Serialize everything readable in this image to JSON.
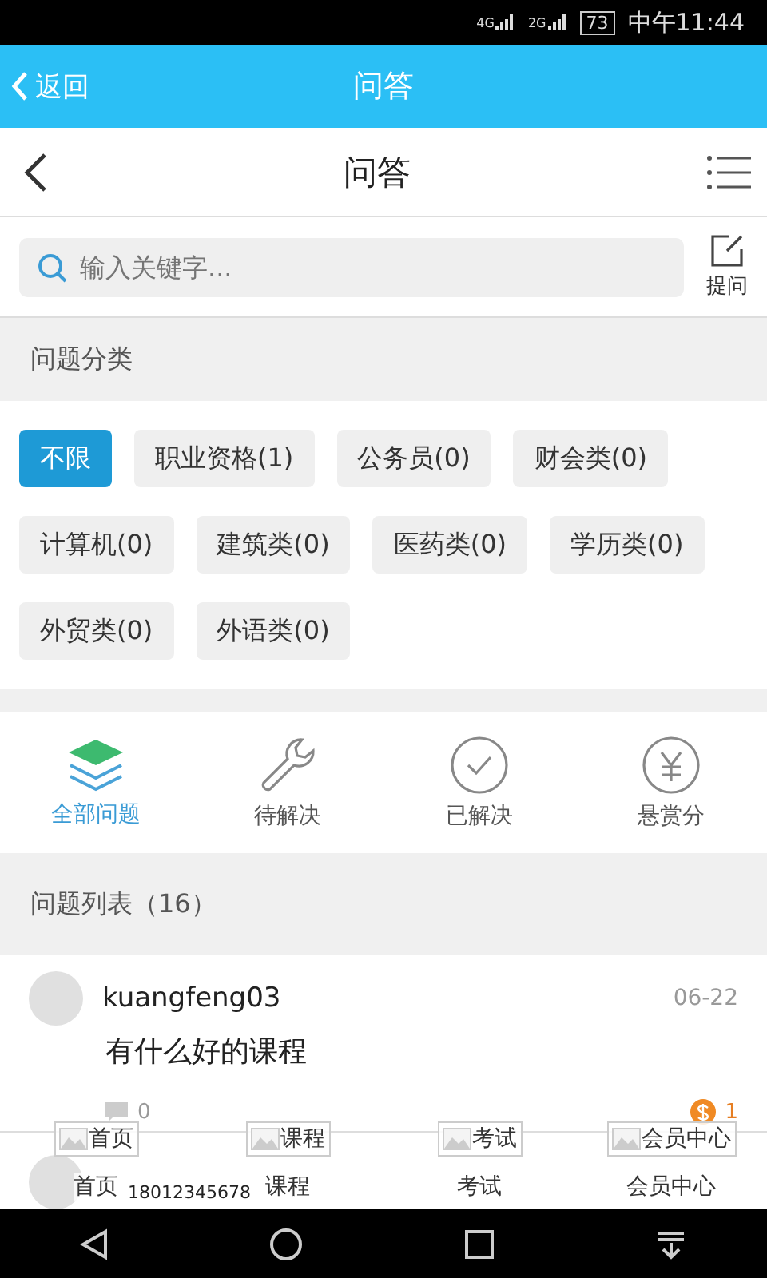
{
  "status_bar": {
    "network_1": "4G",
    "network_2": "2G",
    "battery": "73",
    "time": "中午11:44"
  },
  "app_bar": {
    "back": "返回",
    "title": "问答"
  },
  "header": {
    "title": "问答"
  },
  "search": {
    "placeholder": "输入关键字...",
    "ask": "提问"
  },
  "category_section": {
    "title": "问题分类"
  },
  "categories": [
    {
      "label": "不限",
      "selected": true
    },
    {
      "label": "职业资格(1)",
      "selected": false
    },
    {
      "label": "公务员(0)",
      "selected": false
    },
    {
      "label": "财会类(0)",
      "selected": false
    },
    {
      "label": "计算机(0)",
      "selected": false
    },
    {
      "label": "建筑类(0)",
      "selected": false
    },
    {
      "label": "医药类(0)",
      "selected": false
    },
    {
      "label": "学历类(0)",
      "selected": false
    },
    {
      "label": "外贸类(0)",
      "selected": false
    },
    {
      "label": "外语类(0)",
      "selected": false
    }
  ],
  "filters": [
    {
      "kind": "layers",
      "label": "全部问题",
      "selected": true
    },
    {
      "kind": "wrench",
      "label": "待解决",
      "selected": false
    },
    {
      "kind": "check",
      "label": "已解决",
      "selected": false
    },
    {
      "kind": "yen",
      "label": "悬赏分",
      "selected": false
    }
  ],
  "list_section": {
    "title": "问题列表（16）"
  },
  "questions": [
    {
      "user": "kuangfeng03",
      "date": "06-22",
      "text": "有什么好的课程",
      "comments": "0",
      "reward": "1"
    },
    {
      "user": "18012345678"
    }
  ],
  "bottom_tabs": [
    {
      "image_alt": "首页",
      "label": "首页"
    },
    {
      "image_alt": "课程",
      "label": "课程"
    },
    {
      "image_alt": "考试",
      "label": "考试"
    },
    {
      "image_alt": "会员中心",
      "label": "会员中心"
    }
  ]
}
